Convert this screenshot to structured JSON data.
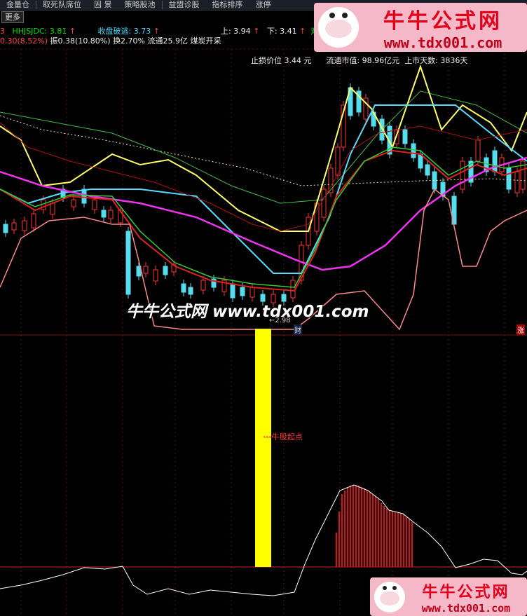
{
  "menu": [
    "金量仓",
    "取死队席位",
    "固 景",
    "策略股池",
    "益盟诊股",
    "指标排序",
    "涨停"
  ],
  "more_button": "更多",
  "indicator_row": {
    "prefix": "3",
    "hhjs": "HHJSJDC: 3.81",
    "shoupan": "收盘破逃: 3.73",
    "upper": "上: 3.94",
    "lower": "下: 3.41",
    "double": "双"
  },
  "quote_row": {
    "change": "0.30(8.52%)",
    "amplitude": "振0.38(10.80%)",
    "turnover": "换2.70%",
    "float": "流通25.9亿",
    "sector": "煤炭开采"
  },
  "stats_row": {
    "stoploss": "止损价位 3.44 元",
    "float_value": "流通市值: 98.96亿元",
    "listed_days": "上市天数: 3836天"
  },
  "chart_labels": {
    "low_marker": "←2.98",
    "cai": "财",
    "zhang": "涨",
    "bull_start": "---牛股起点"
  },
  "watermark": {
    "title": "牛牛公式网",
    "url": "www.tdx001.com",
    "center": "牛牛公式网 www.tdx001.com"
  },
  "colors": {
    "yellow_line": "#ffff66",
    "cyan_line": "#55ddff",
    "purple_line": "#ee33ee",
    "red_line": "#dd2222",
    "green_line": "#33cc33",
    "pink_line": "#ff8888",
    "up_candle": "#ff3333",
    "down_candle": "#55ddee",
    "bull_bar": "#ffff00",
    "hist_bar": "#dd1111"
  }
}
